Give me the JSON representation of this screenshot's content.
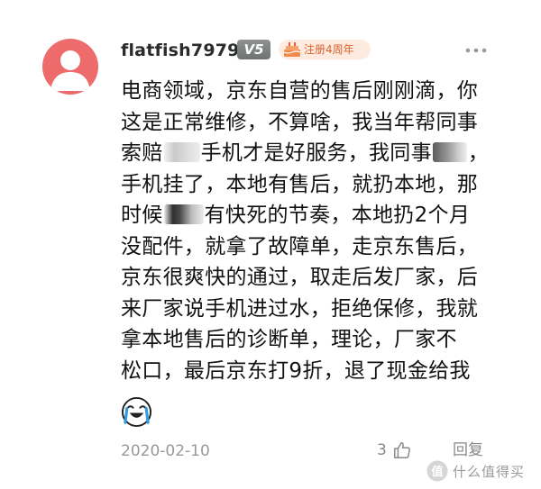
{
  "comment": {
    "author": "flatfish7979",
    "vip_level": "V5",
    "anniversary_badge": "注册4周年",
    "lines": [
      [
        "电商领域，京东自营的售后刚刚滴，你"
      ],
      [
        "这是正常维修，不算啥，我当年帮同事"
      ],
      [
        "索赔",
        "手机才是好服务，我同事",
        "，"
      ],
      [
        "手机挂了，本地有售后，就扔本地，那"
      ],
      [
        "时候",
        "有快死的节奏，本地扔2个月"
      ],
      [
        "没配件，就拿了故障单，走京东售后，"
      ],
      [
        "京东很爽快的通过，取走后发厂家，后"
      ],
      [
        "来厂家说手机进过水，拒绝保修，我就"
      ],
      [
        "拿本地售后的诊断单，理论，厂家不"
      ],
      [
        "松口，最后京东打9折，退了现金给我"
      ]
    ],
    "emoji": "crying-laughing-emoji",
    "date": "2020-02-10",
    "like_count": "3",
    "reply_label": "回复"
  },
  "watermark": {
    "text": "什么值得买"
  },
  "colors": {
    "avatar_bg": "#ee6b6b",
    "vip_badge_bg": "#7f8283",
    "anniversary_text": "#d9612c",
    "anniversary_bg": "#fdebe0",
    "meta_text": "#999999"
  },
  "icons": {
    "avatar": "default-user-avatar-icon",
    "anniversary": "cake-icon",
    "more": "more-dots-icon",
    "like": "thumbs-up-icon",
    "watermark": "smzdm-logo-icon"
  }
}
